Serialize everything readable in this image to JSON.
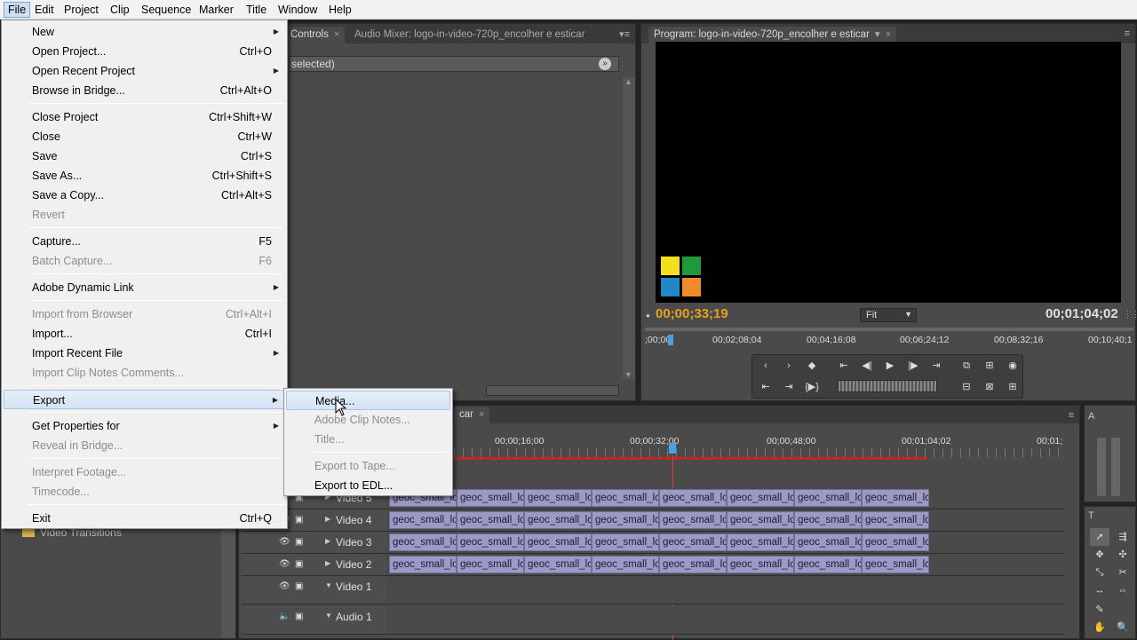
{
  "menubar": [
    "File",
    "Edit",
    "Project",
    "Clip",
    "Sequence",
    "Marker",
    "Title",
    "Window",
    "Help"
  ],
  "source_panel": {
    "tab_controls": "Controls",
    "tab_close": "×",
    "tab_mixer": "Audio Mixer: logo-in-video-720p_encolher e esticar",
    "selection_text": " selected)"
  },
  "program": {
    "tab_label": "Program: logo-in-video-720p_encolher e esticar",
    "current_time": "00;00;33;19",
    "duration": "00;01;04;02",
    "zoom": "Fit",
    "ruler": [
      ";00;00",
      "00;02;08;04",
      "00;04;16;08",
      "00;06;24;12",
      "00;08;32;16",
      "00;10;40;1"
    ]
  },
  "file_menu": [
    {
      "label": "New",
      "shortcut": "",
      "submenu": true,
      "disabled": false
    },
    {
      "label": "Open Project...",
      "shortcut": "Ctrl+O",
      "submenu": false,
      "disabled": false
    },
    {
      "label": "Open Recent Project",
      "shortcut": "",
      "submenu": true,
      "disabled": false
    },
    {
      "label": "Browse in Bridge...",
      "shortcut": "Ctrl+Alt+O",
      "submenu": false,
      "disabled": false
    },
    {
      "label": "Close Project",
      "shortcut": "Ctrl+Shift+W",
      "submenu": false,
      "disabled": false
    },
    {
      "label": "Close",
      "shortcut": "Ctrl+W",
      "submenu": false,
      "disabled": false
    },
    {
      "label": "Save",
      "shortcut": "Ctrl+S",
      "submenu": false,
      "disabled": false
    },
    {
      "label": "Save As...",
      "shortcut": "Ctrl+Shift+S",
      "submenu": false,
      "disabled": false
    },
    {
      "label": "Save a Copy...",
      "shortcut": "Ctrl+Alt+S",
      "submenu": false,
      "disabled": false
    },
    {
      "label": "Revert",
      "shortcut": "",
      "submenu": false,
      "disabled": true
    },
    {
      "label": "Capture...",
      "shortcut": "F5",
      "submenu": false,
      "disabled": false
    },
    {
      "label": "Batch Capture...",
      "shortcut": "F6",
      "submenu": false,
      "disabled": true
    },
    {
      "label": "Adobe Dynamic Link",
      "shortcut": "",
      "submenu": true,
      "disabled": false
    },
    {
      "label": "Import from Browser",
      "shortcut": "Ctrl+Alt+I",
      "submenu": false,
      "disabled": true
    },
    {
      "label": "Import...",
      "shortcut": "Ctrl+I",
      "submenu": false,
      "disabled": false
    },
    {
      "label": "Import Recent File",
      "shortcut": "",
      "submenu": true,
      "disabled": false
    },
    {
      "label": "Import Clip Notes Comments...",
      "shortcut": "",
      "submenu": false,
      "disabled": true
    },
    {
      "label": "Export",
      "shortcut": "",
      "submenu": true,
      "disabled": false
    },
    {
      "label": "Get Properties for",
      "shortcut": "",
      "submenu": true,
      "disabled": false
    },
    {
      "label": "Reveal in Bridge...",
      "shortcut": "",
      "submenu": false,
      "disabled": true
    },
    {
      "label": "Interpret Footage...",
      "shortcut": "",
      "submenu": false,
      "disabled": true
    },
    {
      "label": "Timecode...",
      "shortcut": "",
      "submenu": false,
      "disabled": true
    },
    {
      "label": "Exit",
      "shortcut": "Ctrl+Q",
      "submenu": false,
      "disabled": false
    }
  ],
  "export_submenu": [
    {
      "label": "Media...",
      "disabled": false
    },
    {
      "label": "Adobe Clip Notes...",
      "disabled": true
    },
    {
      "label": "Title...",
      "disabled": true
    },
    {
      "label": "Export to Tape...",
      "disabled": true
    },
    {
      "label": "Export to EDL...",
      "disabled": false
    }
  ],
  "timeline": {
    "tab_fragment": "car",
    "ruler": [
      "00;00;16;00",
      "00;00;32;00",
      "00;00;48;00",
      "00;01;04;02",
      "00;01;"
    ],
    "tracks": [
      "Video 5",
      "Video 4",
      "Video 3",
      "Video 2",
      "Video 1",
      "Audio 1"
    ],
    "clip_label": "geoc_small_lo",
    "clip_label_short": "geoc_small_lc"
  },
  "effects_panel": {
    "video_transitions": "Video Transitions"
  },
  "side_panels": {
    "audio_meter_tab": "A",
    "tools_tab": "T"
  },
  "colors": {
    "accent_timecode": "#e8a21a",
    "clip_fill": "#9a9ac4",
    "playhead": "#e03a3a",
    "menu_highlight": "#d6e3f4"
  }
}
